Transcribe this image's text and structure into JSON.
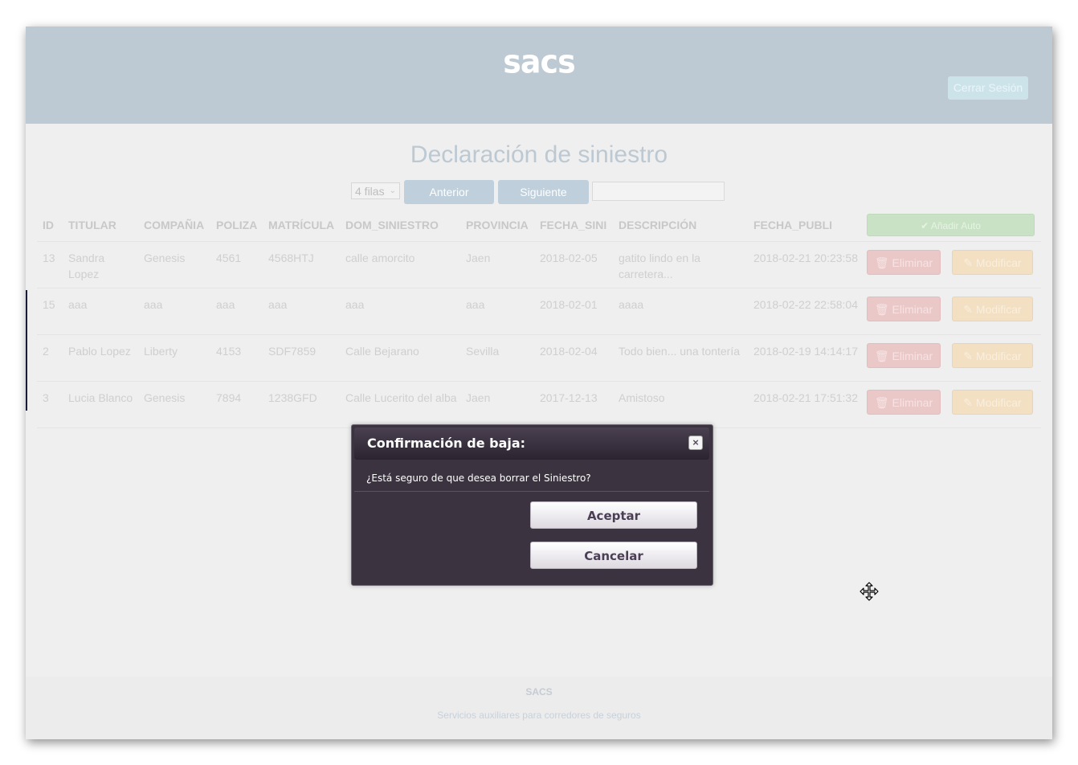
{
  "header": {
    "logo": "sacs",
    "logout_label": "Cerrar Sesión",
    "background": "#bdcad3"
  },
  "main": {
    "title": "Declaración de siniestro",
    "rows_select": "4 filas",
    "prev_label": "Anterior",
    "next_label": "Siguiente",
    "filter_value": "",
    "add_label": "✔ Añadir Auto"
  },
  "table": {
    "columns": [
      "ID",
      "TITULAR",
      "COMPAÑIA",
      "POLIZA",
      "MATRÍCULA",
      "DOM_SINIESTRO",
      "PROVINCIA",
      "FECHA_SINI",
      "DESCRIPCIÓN",
      "FECHA_PUBLI"
    ],
    "rows": [
      {
        "id": "13",
        "titular": "Sandra Lopez",
        "compania": "Genesis",
        "poliza": "4561",
        "matricula": "4568HTJ",
        "domicilio": "calle amorcito",
        "provincia": "Jaen",
        "fecha_sini": "2018-02-05",
        "descripcion": "gatito lindo en la carretera...",
        "fecha_publi": "2018-02-21 20:23:58"
      },
      {
        "id": "15",
        "titular": "aaa",
        "compania": "aaa",
        "poliza": "aaa",
        "matricula": "aaa",
        "domicilio": "aaa",
        "provincia": "aaa",
        "fecha_sini": "2018-02-01",
        "descripcion": "aaaa",
        "fecha_publi": "2018-02-22 22:58:04"
      },
      {
        "id": "2",
        "titular": "Pablo Lopez",
        "compania": "Liberty",
        "poliza": "4153",
        "matricula": "SDF7859",
        "domicilio": "Calle Bejarano",
        "provincia": "Sevilla",
        "fecha_sini": "2018-02-04",
        "descripcion": "Todo bien... una tontería",
        "fecha_publi": "2018-02-19 14:14:17"
      },
      {
        "id": "3",
        "titular": "Lucia Blanco",
        "compania": "Genesis",
        "poliza": "7894",
        "matricula": "1238GFD",
        "domicilio": "Calle Lucerito del alba",
        "provincia": "Jaen",
        "fecha_sini": "2017-12-13",
        "descripcion": "Amistoso",
        "fecha_publi": "2018-02-21 17:51:32"
      }
    ],
    "delete_label": "Eliminar",
    "modify_label": "Modificar"
  },
  "footer": {
    "brand": "SACS",
    "tagline": "Servicios auxiliares para corredores de seguros"
  },
  "dialog": {
    "title": "Confirmación de baja:",
    "message": "¿Está seguro de que desea borrar el Siniestro?",
    "ok_label": "Aceptar",
    "cancel_label": "Cancelar",
    "close_icon": "×"
  },
  "icons": {
    "trash": "trash-icon",
    "pencil": "pencil-icon",
    "check": "check-icon",
    "close": "close-icon",
    "move": "move-cursor-icon"
  }
}
